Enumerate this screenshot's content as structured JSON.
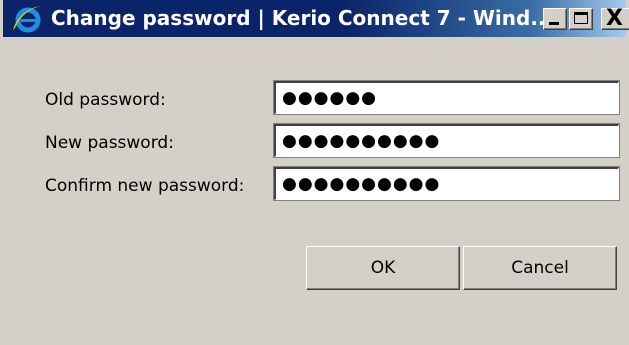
{
  "window": {
    "title": "Change password | Kerio Connect 7 - Wind...",
    "browser_icon": "internet-explorer-icon"
  },
  "caption_buttons": {
    "minimize_icon": "minimize-icon",
    "maximize_icon": "maximize-icon",
    "close_glyph": "X"
  },
  "form": {
    "old_password_label": "Old password:",
    "old_password_value": "●●●●●●",
    "new_password_label": "New password:",
    "new_password_value": "●●●●●●●●●●",
    "confirm_password_label": "Confirm new password:",
    "confirm_password_value": "●●●●●●●●●●"
  },
  "actions": {
    "ok_label": "OK",
    "cancel_label": "Cancel"
  },
  "colors": {
    "titlebar": "#0a246a",
    "dialog_background": "#d4d0c8",
    "ie_icon": "#1e8fe0"
  }
}
